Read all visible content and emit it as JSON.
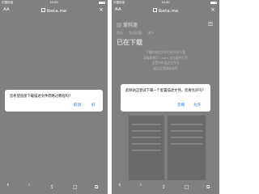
{
  "left": {
    "status": {
      "carrier": "中国电信",
      "time": "10:40"
    },
    "url": {
      "reader_label": "AA",
      "host": "ibeta.me",
      "close": "×"
    },
    "alert": {
      "message": "您希望直接下载描述文件而略过教程吗?",
      "cancel_label": "取消",
      "ok_label": "好"
    },
    "toolbar": {
      "back": "‹",
      "forward": "›",
      "share": "⇪",
      "bookmarks": "□",
      "tabs": "⧉"
    }
  },
  "right": {
    "status": {
      "carrier": "中国电信",
      "time": "10:40"
    },
    "url": {
      "reader_label": "AA",
      "host": "ibeta.me",
      "close": "×"
    },
    "site": {
      "logo": "爱科迷",
      "nav": [
        "首页",
        "常见问题",
        "关于"
      ],
      "heading": "已在下载",
      "desc": [
        "下载的描述文件已经开始下载",
        "请确保使用 Safari 浏览器中打开",
        "设置中有描述文件项",
        "返回设置刷新即可"
      ]
    },
    "alert": {
      "message": "此网站正尝试下载一个配置描述文件。您要允许吗?",
      "ignore_label": "忽略",
      "allow_label": "允许"
    },
    "toolbar": {
      "back": "‹",
      "forward": "›",
      "share": "⇪",
      "bookmarks": "□",
      "tabs": "⧉"
    }
  },
  "colors": {
    "overlay": "#808080",
    "alert_bg": "#ffffff",
    "button_blue": "#1a7cf0"
  }
}
